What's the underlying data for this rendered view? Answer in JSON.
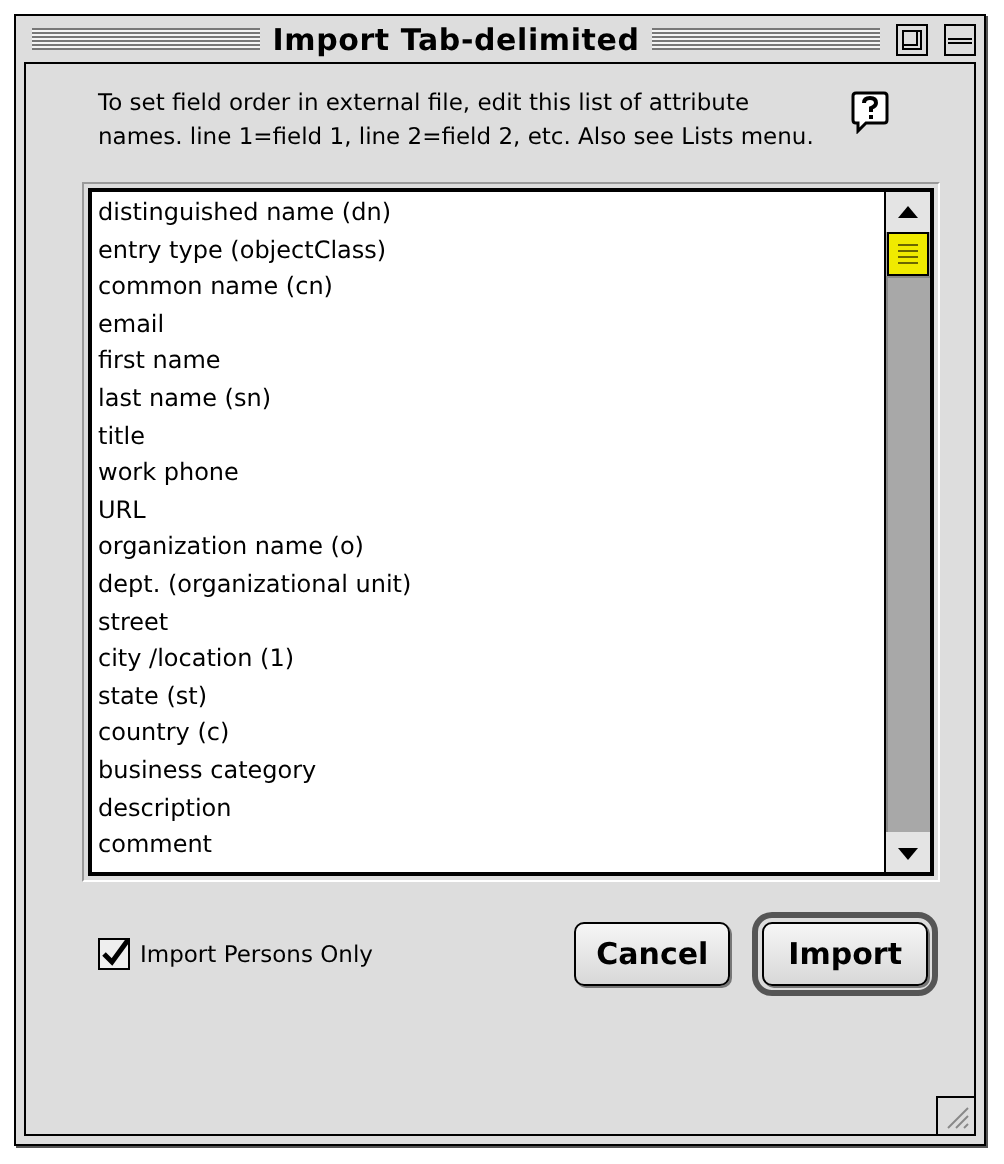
{
  "window": {
    "title": "Import Tab-delimited"
  },
  "instructions": "To set field order in external file, edit this list of attribute names. line 1=field 1, line 2=field 2, etc. Also see Lists menu.",
  "attributes": [
    "distinguished name (dn)",
    "entry type (objectClass)",
    "common name (cn)",
    "email",
    "first name",
    "last name (sn)",
    "title",
    "work phone",
    "URL",
    "organization name (o)",
    "dept. (organizational unit)",
    "street",
    "city /location (1)",
    "state (st)",
    "country (c)",
    "business category",
    "description",
    "comment"
  ],
  "checkbox": {
    "label": "Import Persons Only",
    "checked": true
  },
  "buttons": [
    {
      "label": "Cancel",
      "default": false
    },
    {
      "label": "Import",
      "default": true
    }
  ]
}
